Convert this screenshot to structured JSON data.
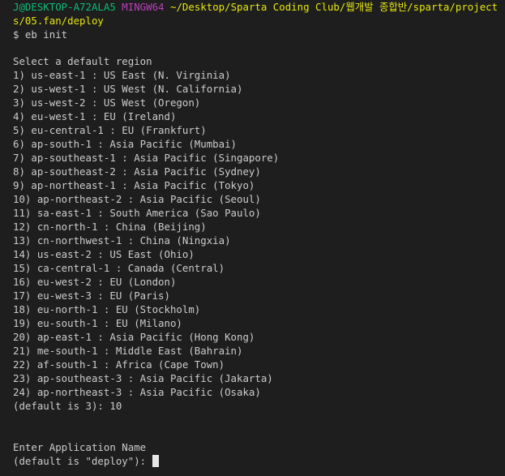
{
  "prompt": {
    "user_host": "J@DESKTOP-A72ALA5",
    "system": "MINGW64",
    "path": "~/Desktop/Sparta Coding Club/웹개발 종합반/sparta/projects/05.fan/deploy",
    "command_line": "$ eb init"
  },
  "region_prompt": {
    "title": "Select a default region",
    "options": [
      "1) us-east-1 : US East (N. Virginia)",
      "2) us-west-1 : US West (N. California)",
      "3) us-west-2 : US West (Oregon)",
      "4) eu-west-1 : EU (Ireland)",
      "5) eu-central-1 : EU (Frankfurt)",
      "6) ap-south-1 : Asia Pacific (Mumbai)",
      "7) ap-southeast-1 : Asia Pacific (Singapore)",
      "8) ap-southeast-2 : Asia Pacific (Sydney)",
      "9) ap-northeast-1 : Asia Pacific (Tokyo)",
      "10) ap-northeast-2 : Asia Pacific (Seoul)",
      "11) sa-east-1 : South America (Sao Paulo)",
      "12) cn-north-1 : China (Beijing)",
      "13) cn-northwest-1 : China (Ningxia)",
      "14) us-east-2 : US East (Ohio)",
      "15) ca-central-1 : Canada (Central)",
      "16) eu-west-2 : EU (London)",
      "17) eu-west-3 : EU (Paris)",
      "18) eu-north-1 : EU (Stockholm)",
      "19) eu-south-1 : EU (Milano)",
      "20) ap-east-1 : Asia Pacific (Hong Kong)",
      "21) me-south-1 : Middle East (Bahrain)",
      "22) af-south-1 : Africa (Cape Town)",
      "23) ap-southeast-3 : Asia Pacific (Jakarta)",
      "24) ap-northeast-3 : Asia Pacific (Osaka)"
    ],
    "default_line": "(default is 3): 10"
  },
  "app_prompt": {
    "title": "Enter Application Name",
    "input_line": "(default is \"deploy\"): "
  },
  "colors": {
    "background": "#1e1e1e",
    "text": "#cccccc",
    "user_host": "#0dbc79",
    "system": "#bc3fbc",
    "path": "#e5e510",
    "cursor": "#e6e6e6"
  }
}
